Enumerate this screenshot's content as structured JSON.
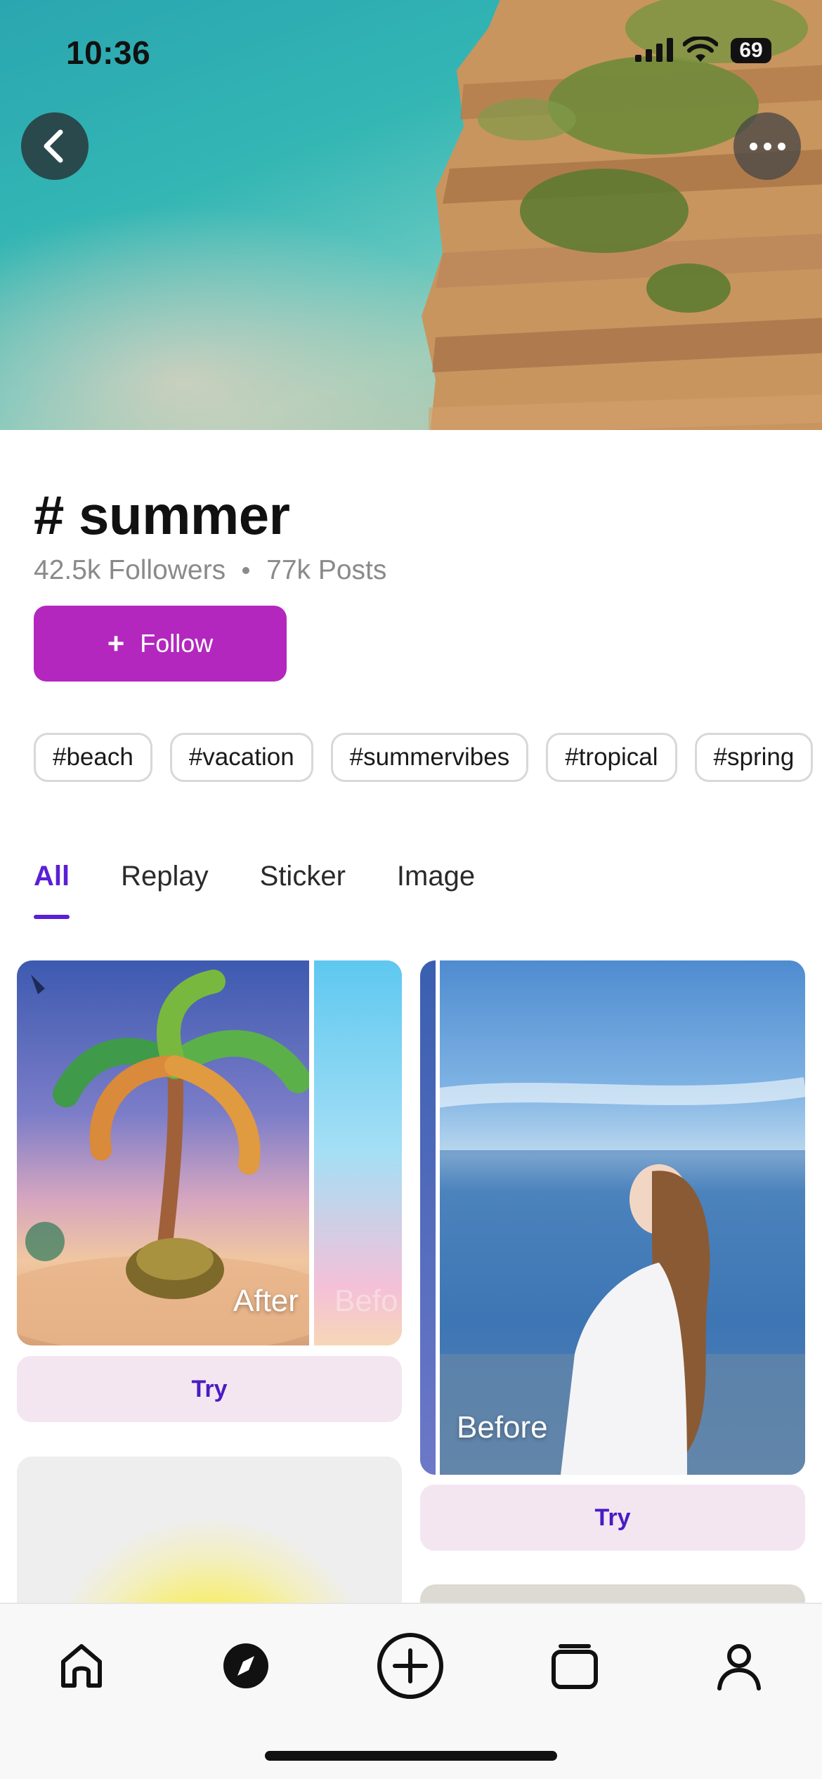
{
  "status_bar": {
    "time": "10:36",
    "battery": "69"
  },
  "header": {
    "back_icon": "chevron-left-icon",
    "more_icon": "ellipsis-icon"
  },
  "hashtag": {
    "title": "# summer",
    "followers": "42.5k Followers",
    "posts": "77k Posts",
    "follow_label": "Follow",
    "follow_color": "#b327be"
  },
  "related_tags": [
    "#beach",
    "#vacation",
    "#summervibes",
    "#tropical",
    "#spring"
  ],
  "tabs": [
    {
      "label": "All",
      "active": true
    },
    {
      "label": "Replay",
      "active": false
    },
    {
      "label": "Sticker",
      "active": false
    },
    {
      "label": "Image",
      "active": false
    }
  ],
  "accent_color": "#5a1fd6",
  "feed": {
    "cards": [
      {
        "overlay_label": "After",
        "faded_label": "Befo",
        "try_label": "Try"
      },
      {
        "overlay_label": "Before",
        "try_label": "Try"
      }
    ]
  },
  "bottom_nav": [
    {
      "icon": "home-icon"
    },
    {
      "icon": "compass-icon",
      "active": true
    },
    {
      "icon": "plus-circle-icon"
    },
    {
      "icon": "library-icon"
    },
    {
      "icon": "profile-icon"
    }
  ]
}
